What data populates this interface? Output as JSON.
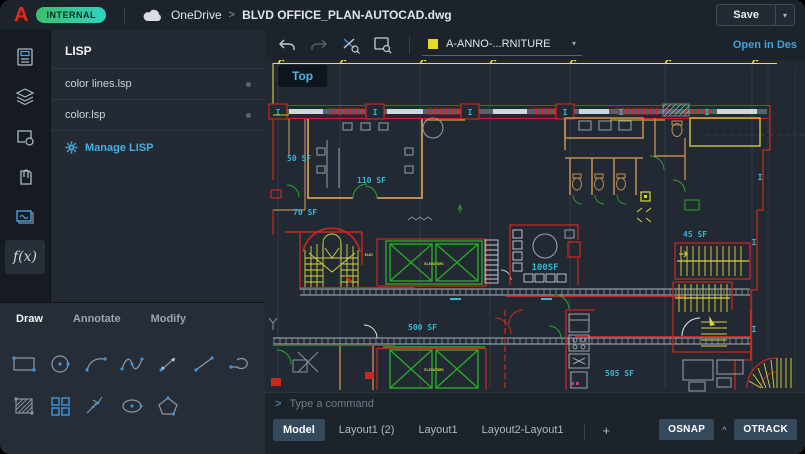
{
  "topbar": {
    "logo": "A",
    "badge": "INTERNAL",
    "breadcrumb": {
      "drive": "OneDrive",
      "separator": ">",
      "file": "BLVD OFFICE_PLAN-AUTOCAD.dwg"
    },
    "save_label": "Save",
    "save_caret": "▾"
  },
  "left_rail": {
    "icons": [
      {
        "name": "properties-panel-icon"
      },
      {
        "name": "layers-icon"
      },
      {
        "name": "blocks-icon"
      },
      {
        "name": "attachments-icon"
      },
      {
        "name": "plot-output-icon"
      },
      {
        "name": "lisp-functions-icon",
        "label": "f(x)",
        "active": true
      }
    ]
  },
  "lisp_panel": {
    "title": "LISP",
    "items": [
      {
        "label": "color lines.lsp"
      },
      {
        "label": "color.lsp"
      }
    ],
    "manage_label": "Manage LISP"
  },
  "tools_panel": {
    "tabs": [
      {
        "label": "Draw",
        "active": true
      },
      {
        "label": "Annotate",
        "active": false
      },
      {
        "label": "Modify",
        "active": false
      }
    ],
    "tools": [
      "rectangle",
      "circle",
      "arc",
      "spline",
      "stretch",
      "line",
      "polyline-arc",
      "hatch",
      "block",
      "dimension",
      "ellipse",
      "polygon"
    ]
  },
  "canvas": {
    "toolbar": {
      "layer": {
        "name": "A-ANNO-...RNITURE",
        "swatch_color": "#e8d928"
      },
      "open_in": "Open in Des",
      "caret": "▾"
    },
    "view_label": "Top",
    "sf_labels": {
      "s50": "50 SF",
      "s110": "110 SF",
      "s70": "70 SF",
      "s100": "100SF",
      "s45": "45 SF",
      "s500": "500 SF",
      "s505": "505 SF"
    },
    "tiny_labels": {
      "elevators": "ELEVATORS",
      "elec": "ELEC"
    }
  },
  "command_bar": {
    "prompt": ">",
    "placeholder": "Type a command"
  },
  "status_bar": {
    "tabs": [
      {
        "label": "Model",
        "active": true
      },
      {
        "label": "Layout1 (2)",
        "active": false
      },
      {
        "label": "Layout1",
        "active": false
      },
      {
        "label": "Layout2-Layout1",
        "active": false
      }
    ],
    "add_label": "+",
    "osnap": "OSNAP",
    "caret": "^",
    "otrack": "OTRACK"
  },
  "colors": {
    "accent": "#3f97e0",
    "cad_red": "#c8281e",
    "cad_yellow": "#e6e63c",
    "cad_green": "#2fa32f",
    "cad_cyan": "#3ab8d8",
    "cad_tan": "#bd8d54"
  }
}
